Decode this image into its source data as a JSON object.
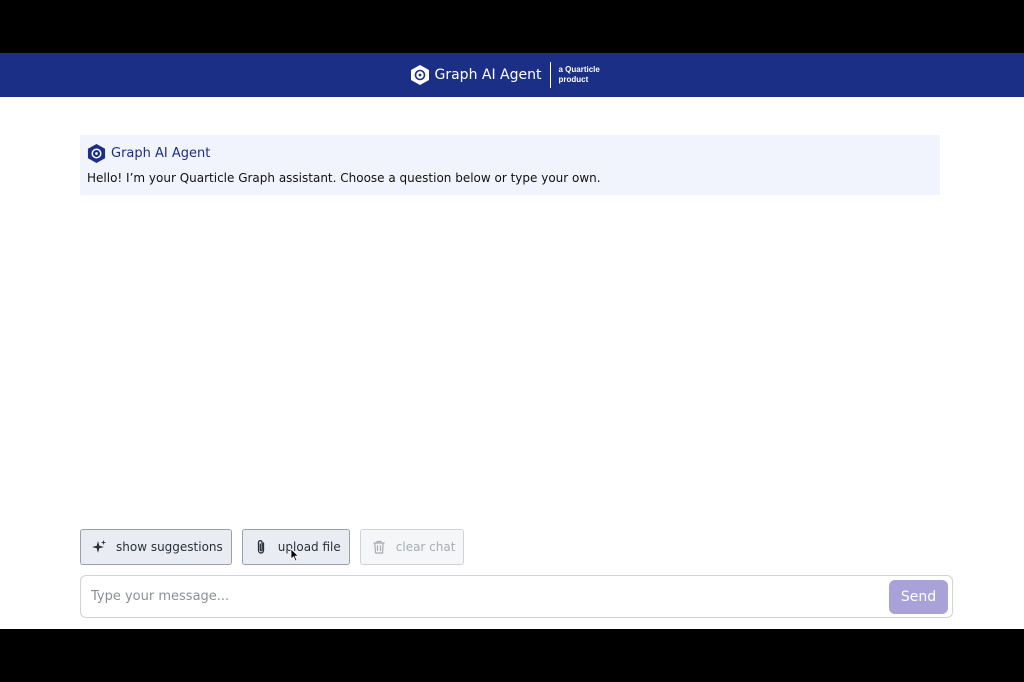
{
  "header": {
    "title": "Graph AI Agent",
    "subtitle_line1": "a Quarticle",
    "subtitle_line2": "product"
  },
  "chat": {
    "messages": [
      {
        "sender": "Graph AI Agent",
        "text": "Hello! I’m your Quarticle Graph assistant. Choose a question below or type your own."
      }
    ]
  },
  "actions": {
    "show_suggestions": "show suggestions",
    "upload_file": "upload file",
    "clear_chat": "clear chat"
  },
  "composer": {
    "placeholder": "Type your message...",
    "value": "",
    "send_label": "Send"
  },
  "colors": {
    "header_bg": "#1c2f86",
    "message_bg": "#f1f4fc",
    "send_bg": "#a8a2d8"
  },
  "icons": {
    "brand": "hexagon-logo-icon",
    "suggestions": "sparkles-icon",
    "upload": "paperclip-icon",
    "clear": "trash-icon"
  }
}
